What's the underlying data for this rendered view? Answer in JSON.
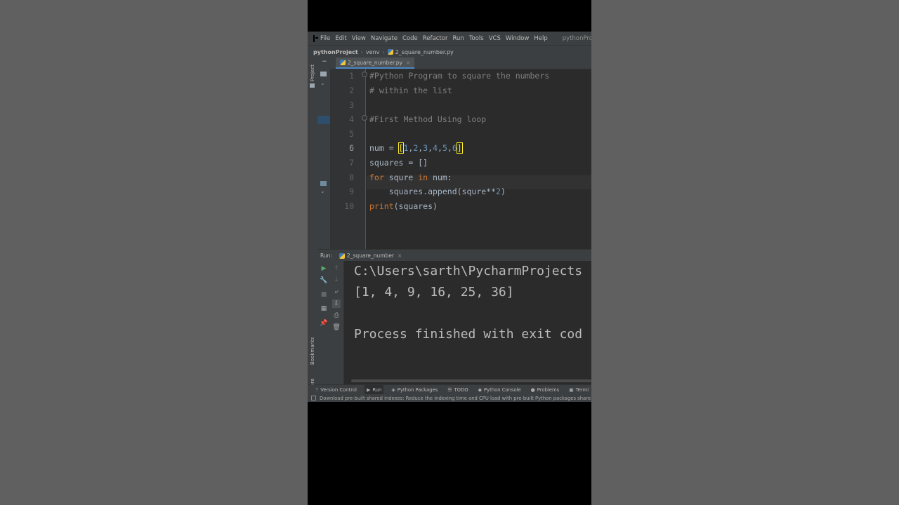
{
  "menubar": {
    "items": [
      "File",
      "Edit",
      "View",
      "Navigate",
      "Code",
      "Refactor",
      "Run",
      "Tools",
      "VCS",
      "Window",
      "Help"
    ],
    "window_title": "pythonProject - C:\\"
  },
  "navbar": {
    "project": "pythonProject",
    "folder": "venv",
    "file": "2_square_number.py"
  },
  "side_labels": {
    "project": "Project",
    "bookmarks": "Bookmarks",
    "structure": "Structure"
  },
  "editor": {
    "tab_label": "2_square_number.py",
    "line_numbers": [
      "1",
      "2",
      "3",
      "4",
      "5",
      "6",
      "7",
      "8",
      "9",
      "10"
    ],
    "current_line": "6",
    "lines": {
      "l1": "#Python Program to square the numbers",
      "l2": "# within the list",
      "l4": "#First Method Using loop",
      "l6_var": "num = ",
      "l6_open": "[",
      "l6_n1": "1",
      "l6_n2": "2",
      "l6_n3": "3",
      "l6_n4": "4",
      "l6_n5": "5",
      "l6_n6": "6",
      "comma": ",",
      "l6_close": "]",
      "l7": "squares = []",
      "l8_kw_for": "for",
      "l8_var": " squre ",
      "l8_kw_in": "in",
      "l8_rest": " num:",
      "l9_text": "    squares.append(squre**",
      "l9_num": "2",
      "l9_close": ")",
      "l10_fn": "print",
      "l10_rest": "(squares)"
    }
  },
  "run_panel": {
    "label": "Run:",
    "tab_label": "2_square_number",
    "output": [
      "C:\\Users\\sarth\\PycharmProjects",
      "[1, 4, 9, 16, 25, 36]",
      "",
      "Process finished with exit cod"
    ]
  },
  "bottom_tabs": [
    "Version Control",
    "Run",
    "Python Packages",
    "TODO",
    "Python Console",
    "Problems",
    "Termi"
  ],
  "status": {
    "message": "Download pre-built shared indexes: Reduce the indexing time and CPU load with pre-built Python packages share"
  }
}
